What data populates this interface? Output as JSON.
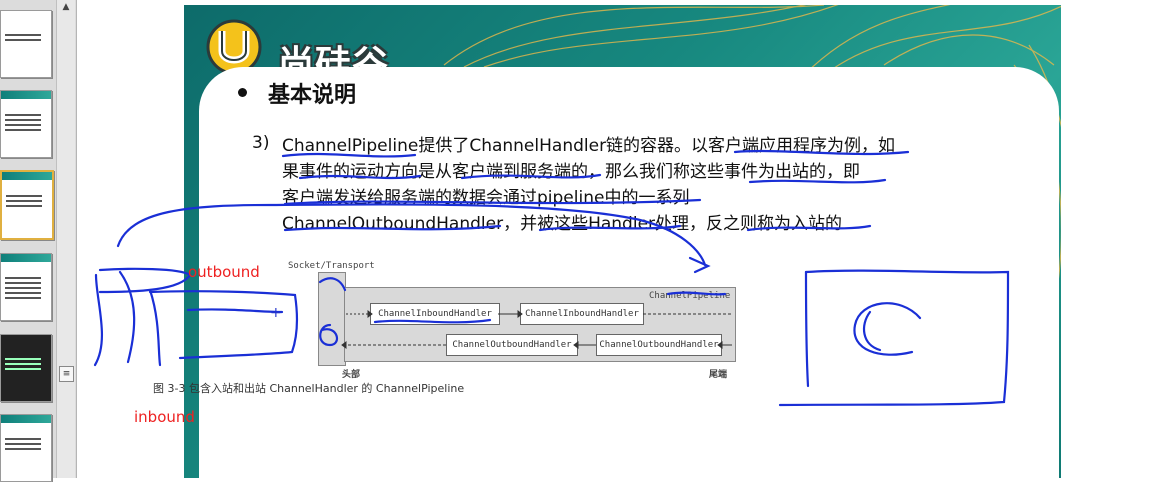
{
  "slide": {
    "logo_text": "尚硅谷",
    "heading": "基本说明",
    "paragraph": {
      "number": "3)",
      "lines": [
        "ChannelPipeline提供了ChannelHandler链的容器。以客户端应用程序为例，如",
        "果事件的运动方向是从客户端到服务端的，那么我们称这些事件为出站的，即",
        "客户端发送给服务端的数据会通过pipeline中的一系列",
        "ChannelOutboundHandler，并被这些Handler处理，反之则称为入站的"
      ]
    },
    "figure": {
      "socket_label": "Socket/Transport",
      "pipeline_label": "ChannelPipeline",
      "inbound_handler_1": "ChannelInboundHandler",
      "inbound_handler_2": "ChannelInboundHandler",
      "outbound_handler_1": "ChannelOutboundHandler",
      "outbound_handler_2": "ChannelOutboundHandler",
      "head_label": "头部",
      "tail_label": "尾端",
      "caption": "图 3-3   包含入站和出站 ChannelHandler 的 ChannelPipeline"
    }
  },
  "annotations": {
    "outbound_label": "outbound",
    "inbound_label": "inbound",
    "ink_color": "#1a2fd6",
    "label_color": "#ee2222"
  },
  "thumbnails": {
    "count": 6,
    "selected_index": 2
  }
}
